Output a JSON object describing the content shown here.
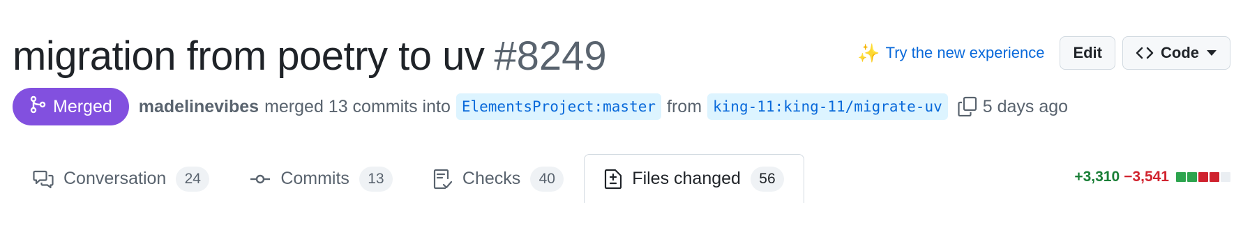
{
  "header": {
    "title": "migration from poetry to uv",
    "number": "#8249",
    "try_new": "Try the new experience",
    "edit_label": "Edit",
    "code_label": "Code"
  },
  "meta": {
    "state": "Merged",
    "author": "madelinevibes",
    "merged_text": "merged 13 commits into",
    "base_branch": "ElementsProject:master",
    "from_text": "from",
    "head_branch": "king-11:king-11/migrate-uv",
    "time": "5 days ago"
  },
  "tabs": [
    {
      "label": "Conversation",
      "count": "24",
      "icon": "comment-discussion-icon"
    },
    {
      "label": "Commits",
      "count": "13",
      "icon": "git-commit-icon"
    },
    {
      "label": "Checks",
      "count": "40",
      "icon": "checklist-icon"
    },
    {
      "label": "Files changed",
      "count": "56",
      "icon": "file-diff-icon",
      "selected": true
    }
  ],
  "diffstat": {
    "additions": "+3,310",
    "deletions": "−3,541",
    "blocks": [
      "green",
      "green",
      "red",
      "red",
      "gray"
    ]
  },
  "colors": {
    "merged": "#8250df",
    "link": "#0969da",
    "additions": "#1a7f37",
    "deletions": "#d1242f",
    "block_green": "#2da44e",
    "block_red": "#cf222e",
    "block_gray": "#eaeef2"
  }
}
